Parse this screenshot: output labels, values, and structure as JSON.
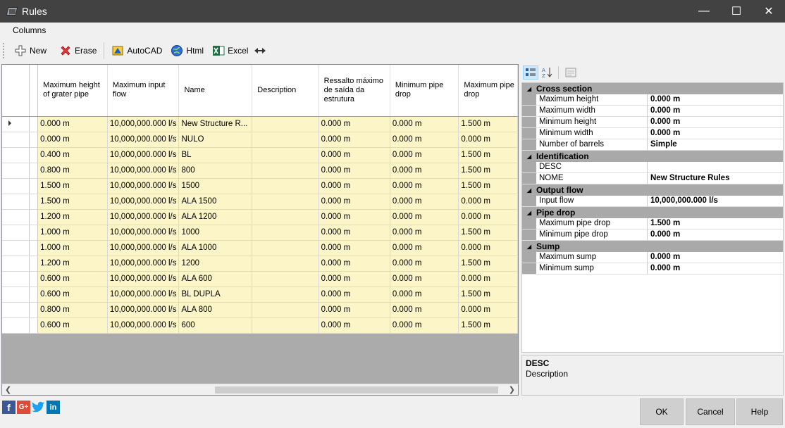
{
  "window": {
    "title": "Rules",
    "minimize": "—",
    "maximize": "☐",
    "close": "✕"
  },
  "menu": {
    "columns": "Columns"
  },
  "toolbar": {
    "new": "New",
    "erase": "Erase",
    "autocad": "AutoCAD",
    "html": "Html",
    "excel": "Excel"
  },
  "grid": {
    "columns": [
      "Maximum height of grater pipe",
      "Maximum input flow",
      "Name",
      "Description",
      "Ressalto máximo de saída da estrutura",
      "Minimum pipe drop",
      "Maximum pipe drop"
    ],
    "rows": [
      [
        "0.000 m",
        "10,000,000.000 l/s",
        "New Structure R...",
        "",
        "0.000 m",
        "0.000 m",
        "1.500 m"
      ],
      [
        "0.000 m",
        "10,000,000.000 l/s",
        "NULO",
        "",
        "0.000 m",
        "0.000 m",
        "0.000 m"
      ],
      [
        "0.400 m",
        "10,000,000.000 l/s",
        "BL",
        "",
        "0.000 m",
        "0.000 m",
        "1.500 m"
      ],
      [
        "0.800 m",
        "10,000,000.000 l/s",
        "800",
        "",
        "0.000 m",
        "0.000 m",
        "1.500 m"
      ],
      [
        "1.500 m",
        "10,000,000.000 l/s",
        "1500",
        "",
        "0.000 m",
        "0.000 m",
        "1.500 m"
      ],
      [
        "1.500 m",
        "10,000,000.000 l/s",
        "ALA 1500",
        "",
        "0.000 m",
        "0.000 m",
        "0.000 m"
      ],
      [
        "1.200 m",
        "10,000,000.000 l/s",
        "ALA 1200",
        "",
        "0.000 m",
        "0.000 m",
        "0.000 m"
      ],
      [
        "1.000 m",
        "10,000,000.000 l/s",
        "1000",
        "",
        "0.000 m",
        "0.000 m",
        "1.500 m"
      ],
      [
        "1.000 m",
        "10,000,000.000 l/s",
        "ALA 1000",
        "",
        "0.000 m",
        "0.000 m",
        "0.000 m"
      ],
      [
        "1.200 m",
        "10,000,000.000 l/s",
        "1200",
        "",
        "0.000 m",
        "0.000 m",
        "1.500 m"
      ],
      [
        "0.600 m",
        "10,000,000.000 l/s",
        "ALA 600",
        "",
        "0.000 m",
        "0.000 m",
        "0.000 m"
      ],
      [
        "0.600 m",
        "10,000,000.000 l/s",
        "BL DUPLA",
        "",
        "0.000 m",
        "0.000 m",
        "1.500 m"
      ],
      [
        "0.800 m",
        "10,000,000.000 l/s",
        "ALA 800",
        "",
        "0.000 m",
        "0.000 m",
        "0.000 m"
      ],
      [
        "0.600 m",
        "10,000,000.000 l/s",
        "600",
        "",
        "0.000 m",
        "0.000 m",
        "1.500 m"
      ]
    ]
  },
  "properties": {
    "categories": [
      {
        "name": "Cross section",
        "items": [
          {
            "label": "Maximum height",
            "value": "0.000 m"
          },
          {
            "label": "Maximum width",
            "value": "0.000 m"
          },
          {
            "label": "Minimum height",
            "value": "0.000 m"
          },
          {
            "label": "Minimum width",
            "value": "0.000 m"
          },
          {
            "label": "Number of barrels",
            "value": "Simple"
          }
        ]
      },
      {
        "name": "Identification",
        "items": [
          {
            "label": "DESC",
            "value": ""
          },
          {
            "label": "NOME",
            "value": "New Structure Rules"
          }
        ]
      },
      {
        "name": "Output flow",
        "items": [
          {
            "label": "Input flow",
            "value": "10,000,000.000 l/s"
          }
        ]
      },
      {
        "name": "Pipe drop",
        "items": [
          {
            "label": "Maximum pipe drop",
            "value": "1.500 m"
          },
          {
            "label": "Minimum pipe drop",
            "value": "0.000 m"
          }
        ]
      },
      {
        "name": "Sump",
        "items": [
          {
            "label": "Maximum sump",
            "value": "0.000 m"
          },
          {
            "label": "Minimum sump",
            "value": "0.000 m"
          }
        ]
      }
    ],
    "description": {
      "title": "DESC",
      "text": "Description"
    }
  },
  "buttons": {
    "ok": "OK",
    "cancel": "Cancel",
    "help": "Help"
  },
  "colors": {
    "row_fill": "#fbf5c8",
    "category": "#a9a9a9",
    "titlebar": "#424242"
  }
}
